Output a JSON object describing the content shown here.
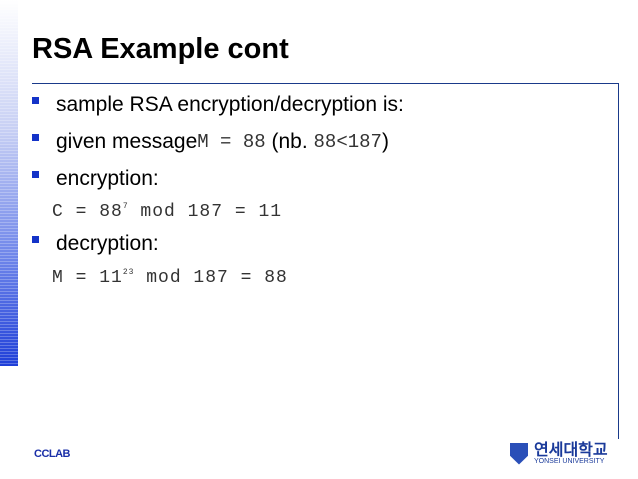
{
  "title": "RSA Example cont",
  "bullets": [
    {
      "text": "sample RSA encryption/decryption is:"
    },
    {
      "prefix": "given message ",
      "code": "M = 88",
      "mid": " (nb. ",
      "code2": "88<187",
      "suffix": ")"
    },
    {
      "text": "encryption:"
    },
    {
      "text": "decryption:"
    }
  ],
  "encryption": {
    "lhs": "C = 88",
    "exp": "7",
    "rhs": " mod 187 = 11"
  },
  "decryption": {
    "lhs": "M = 11",
    "exp": "23",
    "rhs": " mod 187 = 88"
  },
  "footer": {
    "left": "CCLAB",
    "logo_korean": "연세대학교",
    "logo_english": "YONSEI UNIVERSITY"
  },
  "colors": {
    "accent": "#1433c8",
    "rule": "#1a3a8a"
  }
}
